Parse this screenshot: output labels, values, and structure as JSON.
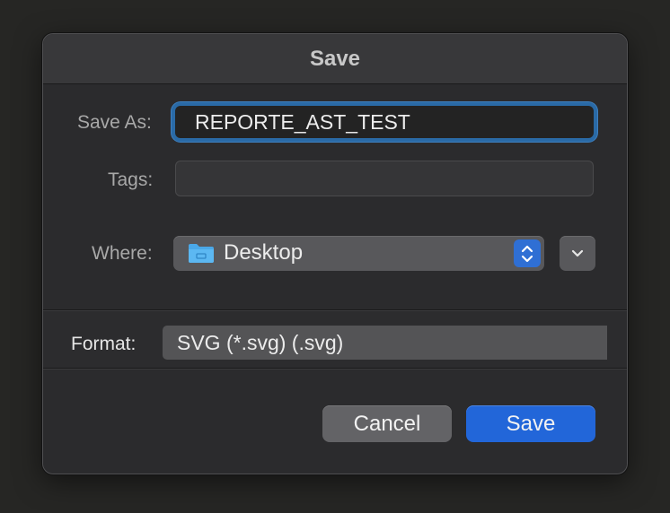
{
  "dialog": {
    "title": "Save",
    "save_as": {
      "label": "Save As:",
      "value": "REPORTE_AST_TEST"
    },
    "tags": {
      "label": "Tags:",
      "value": ""
    },
    "where": {
      "label": "Where:",
      "value": "Desktop",
      "icon": "folder-icon"
    },
    "format": {
      "label": "Format:",
      "value": "SVG (*.svg) (.svg)"
    },
    "buttons": {
      "cancel": "Cancel",
      "save": "Save"
    }
  },
  "colors": {
    "accent": "#2266d9",
    "focus_ring": "#2a6aa6",
    "folder": "#4aa8e8"
  }
}
